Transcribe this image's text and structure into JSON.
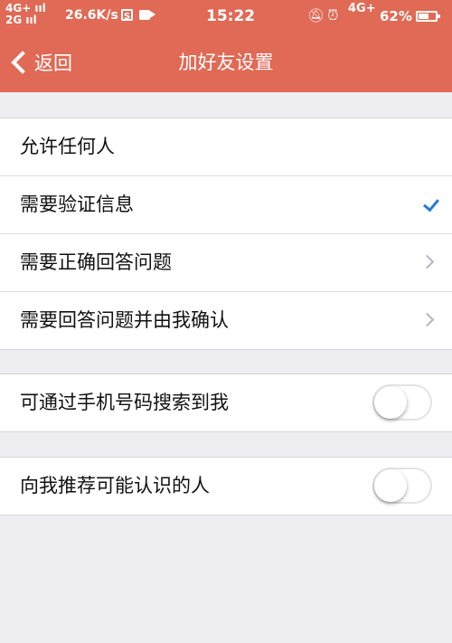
{
  "status_bar": {
    "signal_top": "4G+ ııl",
    "signal_bottom": "2G ııl",
    "speed": "26.6K/s",
    "box_glyph": "S",
    "time": "15:22",
    "network": "4G+",
    "battery_percent": "62%",
    "battery_level": 0.62
  },
  "nav": {
    "back_label": "返回",
    "title": "加好友设置"
  },
  "verification_options": [
    {
      "label": "允许任何人",
      "accessory": "none"
    },
    {
      "label": "需要验证信息",
      "accessory": "check"
    },
    {
      "label": "需要正确回答问题",
      "accessory": "chevron"
    },
    {
      "label": "需要回答问题并由我确认",
      "accessory": "chevron"
    }
  ],
  "phone_search": {
    "label": "可通过手机号码搜索到我",
    "on": false
  },
  "recommend": {
    "label": "向我推荐可能认识的人",
    "on": false
  },
  "colors": {
    "accent": "#e06a55",
    "check": "#2a79d8",
    "background": "#eeeef2"
  }
}
